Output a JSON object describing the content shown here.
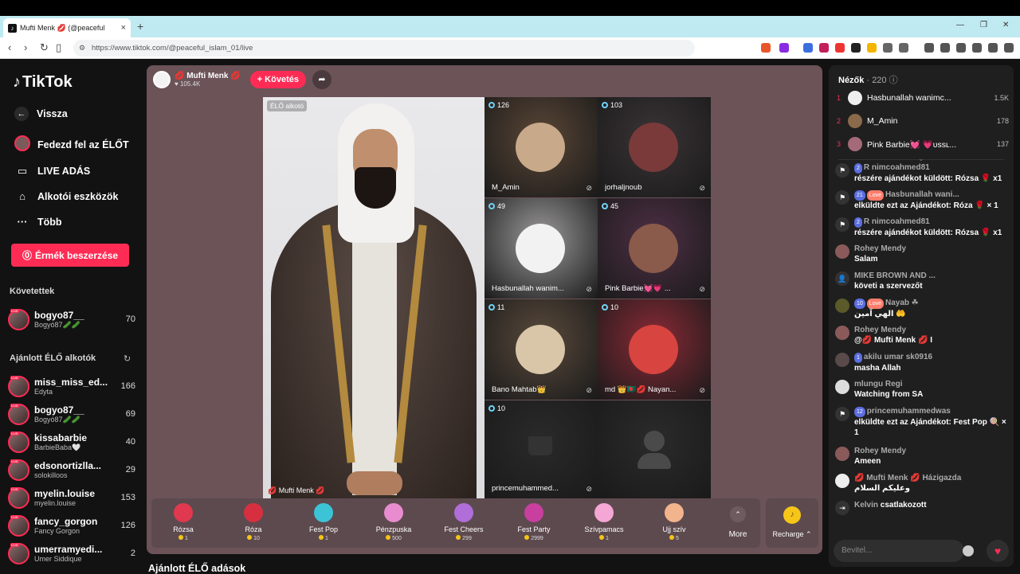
{
  "browser": {
    "tab_title": "Mufti Menk 💋 (@peaceful",
    "url": "https://www.tiktok.com/@peaceful_islam_01/live"
  },
  "sidebar": {
    "brand": "TikTok",
    "nav": [
      {
        "label": "Vissza",
        "icon": "back-arrow-icon"
      },
      {
        "label": "Fedezd fel az ÉLŐT",
        "icon": "explore-live-icon"
      },
      {
        "label": "LIVE ADÁS",
        "icon": "video-camera-icon"
      },
      {
        "label": "Alkotói eszközök",
        "icon": "home-icon"
      },
      {
        "label": "Több",
        "icon": "more-dots-icon"
      }
    ],
    "buy_button": "Érmék beszerzése",
    "following_header": "Követettek",
    "following": [
      {
        "name": "bogyo87__",
        "sub": "Bogyó87🥒🥒",
        "count": "70"
      }
    ],
    "suggested_header": "Ajánlott ÉLŐ alkotók",
    "suggested": [
      {
        "name": "miss_miss_ed...",
        "sub": "Edyta",
        "count": "166"
      },
      {
        "name": "bogyo87__",
        "sub": "Bogyó87🥒🥒",
        "count": "69"
      },
      {
        "name": "kissabarbie",
        "sub": "BarbieBaba🤍",
        "count": "40"
      },
      {
        "name": "edsonortizlla...",
        "sub": "solokilloos",
        "count": "29"
      },
      {
        "name": "myelin.louise",
        "sub": "myelin.louise",
        "count": "153"
      },
      {
        "name": "fancy_gorgon",
        "sub": "Fancy Gorgon",
        "count": "126"
      },
      {
        "name": "umerramyedi...",
        "sub": "Umer Siddique",
        "count": "2"
      }
    ]
  },
  "stage": {
    "host_name": "💋 Mufti Menk 💋",
    "host_likes": "♥ 105.4K",
    "follow_button": "+ Követés",
    "main_tag": "ÉLŐ alkotó",
    "main_name": "💋 Mufti Menk 💋",
    "tiles": [
      {
        "count": "126",
        "name": "M_Amin",
        "color": "#5a4636"
      },
      {
        "count": "103",
        "name": "jorhaljnoub",
        "color": "#3a3436"
      },
      {
        "count": "49",
        "name": "Hasbunallah wanim...",
        "color": "#9c9a9a"
      },
      {
        "count": "45",
        "name": "Pink Barbie💓💗 ...",
        "color": "#4e2f45"
      },
      {
        "count": "11",
        "name": "Bano Mahtab👑",
        "color": "#5a4a3c"
      },
      {
        "count": "10",
        "name": "md 👑🇧🇩💋 Nayan...",
        "color": "#8a2a36"
      },
      {
        "count": "10",
        "name": "princemuhammed...",
        "color": "#2a2a2a"
      },
      {
        "count": "",
        "name": "",
        "color": "#2b2b2b"
      }
    ],
    "gifts": [
      {
        "name": "Rózsa",
        "price": "1",
        "color": "#e0394f"
      },
      {
        "name": "Róza",
        "price": "10",
        "color": "#d63040"
      },
      {
        "name": "Fest Pop",
        "price": "1",
        "color": "#3cc4d6"
      },
      {
        "name": "Pénzpuska",
        "price": "500",
        "color": "#e88ccf"
      },
      {
        "name": "Fest Cheers",
        "price": "299",
        "color": "#b06ed8"
      },
      {
        "name": "Fest Party",
        "price": "2999",
        "color": "#c83fa0"
      },
      {
        "name": "Szívpamacs",
        "price": "1",
        "color": "#f4a6d4"
      },
      {
        "name": "Ujj szív",
        "price": "5",
        "color": "#f2b48c"
      }
    ],
    "more_label": "More",
    "recharge_label": "Recharge ⌃"
  },
  "below_title": "Ajánlott ÉLŐ adások",
  "viewers": {
    "label": "Nézők",
    "count": "· 220",
    "top": [
      {
        "rank": "1",
        "name": "Hasbunallah wanimc...",
        "score": "1.5K"
      },
      {
        "rank": "2",
        "name": "M_Amin",
        "score": "178"
      },
      {
        "rank": "3",
        "name": "Pink Barbie💓 💗ᴜssʟ...",
        "score": "137"
      }
    ]
  },
  "chat": [
    {
      "who": "R nimcoahmed81",
      "level": "2",
      "text": "részére ajándékot küldött: Rózsa 🌹 x1",
      "avatar_color": "#444",
      "kind": "gift"
    },
    {
      "who": "Hasbunallah wani...",
      "level": "21",
      "pill": "Love",
      "text": "elküldte ezt az Ajándékot: Róza 🌹 × 1",
      "avatar_color": "#444",
      "kind": "gift"
    },
    {
      "who": "R nimcoahmed81",
      "level": "2",
      "text": "részére ajándékot küldött: Rózsa 🌹 x1",
      "avatar_color": "#444",
      "kind": "gift"
    },
    {
      "who": "Rohey Mendy",
      "level": "",
      "text": "Salam",
      "avatar_color": "#8a5a5a",
      "kind": "msg"
    },
    {
      "who": "MIKE BROWN AND ...",
      "level": "",
      "text": "követi a szervezőt",
      "avatar_color": "#444",
      "kind": "follow"
    },
    {
      "who": "Nayab ☘",
      "level": "10",
      "pill": "Love",
      "text": "الهي آمين 🤲",
      "avatar_color": "#5a5a2a",
      "kind": "msg"
    },
    {
      "who": "Rohey Mendy",
      "level": "",
      "text": "@💋 Mufti Menk 💋 I",
      "avatar_color": "#8a5a5a",
      "kind": "msg"
    },
    {
      "who": "akilu umar sk0916",
      "level": "1",
      "text": "masha Allah",
      "avatar_color": "#5a4a4a",
      "kind": "msg"
    },
    {
      "who": "mlungu Regi",
      "level": "",
      "text": "Watching from SA",
      "avatar_color": "#ddd",
      "kind": "msg"
    },
    {
      "who": "princemuhammedwas",
      "level": "12",
      "text": "elküldte ezt az Ajándékot: Fest Pop 🍭 × 1",
      "avatar_color": "#444",
      "kind": "gift"
    },
    {
      "who": "Rohey Mendy",
      "level": "",
      "text": "Ameen",
      "avatar_color": "#8a5a5a",
      "kind": "msg"
    },
    {
      "who": "💋 Mufti Menk 💋 Házigazda",
      "level": "",
      "text": "وعليكم السلام",
      "avatar_color": "#eee",
      "kind": "msg"
    },
    {
      "who": "Kelvin",
      "level": "",
      "text": "csatlakozott",
      "avatar_color": "#444",
      "kind": "join"
    }
  ],
  "input_placeholder": "Bevitel..."
}
